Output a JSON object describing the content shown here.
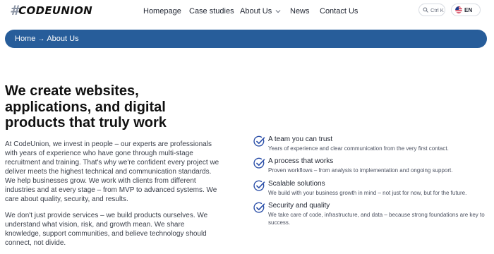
{
  "header": {
    "logo_text": "CODEUNION",
    "logo_mark": "#",
    "nav": [
      {
        "label": "Homepage"
      },
      {
        "label": "Case studies"
      },
      {
        "label": "About Us",
        "has_dropdown": true
      },
      {
        "label": "News"
      },
      {
        "label": "Contact Us"
      }
    ],
    "search": {
      "shortcut": "Ctrl K",
      "icon": "search-icon"
    },
    "language": {
      "code": "EN",
      "icon": "us-flag-icon"
    }
  },
  "breadcrumb": {
    "items": [
      {
        "label": "Home"
      },
      {
        "label": "About Us"
      }
    ],
    "separator": "→"
  },
  "hero": {
    "title": "We create websites, applications, and digital products that truly work",
    "paragraphs": [
      "At CodeUnion, we invest in people – our experts are professionals with years of experience who have gone through multi-stage recruitment and training. That's why we're confident every project we deliver meets the highest technical and communication standards. We help businesses grow. We work with clients from different industries and at every stage – from MVP to advanced systems. We care about quality, security, and results.",
      "We don't just provide services – we build products ourselves. We understand what vision, risk, and growth mean. We share knowledge, support communities, and believe technology should connect, not divide."
    ]
  },
  "features": [
    {
      "title": "A team you can trust",
      "description": "Years of experience and clear communication from the very first contact.",
      "icon": "check-circle-icon"
    },
    {
      "title": "A process that works",
      "description": "Proven workflows – from analysis to implementation and ongoing support.",
      "icon": "check-circle-icon"
    },
    {
      "title": "Scalable solutions",
      "description": "We build with your business growth in mind – not just for now, but for the future.",
      "icon": "check-circle-icon"
    },
    {
      "title": "Security and quality",
      "description": "We take care of code, infrastructure, and data – because strong foundations are key to success.",
      "icon": "check-circle-icon"
    }
  ],
  "colors": {
    "accent": "#275d9a",
    "check_icon": "#2b4fa8",
    "text": "#1f2430"
  }
}
